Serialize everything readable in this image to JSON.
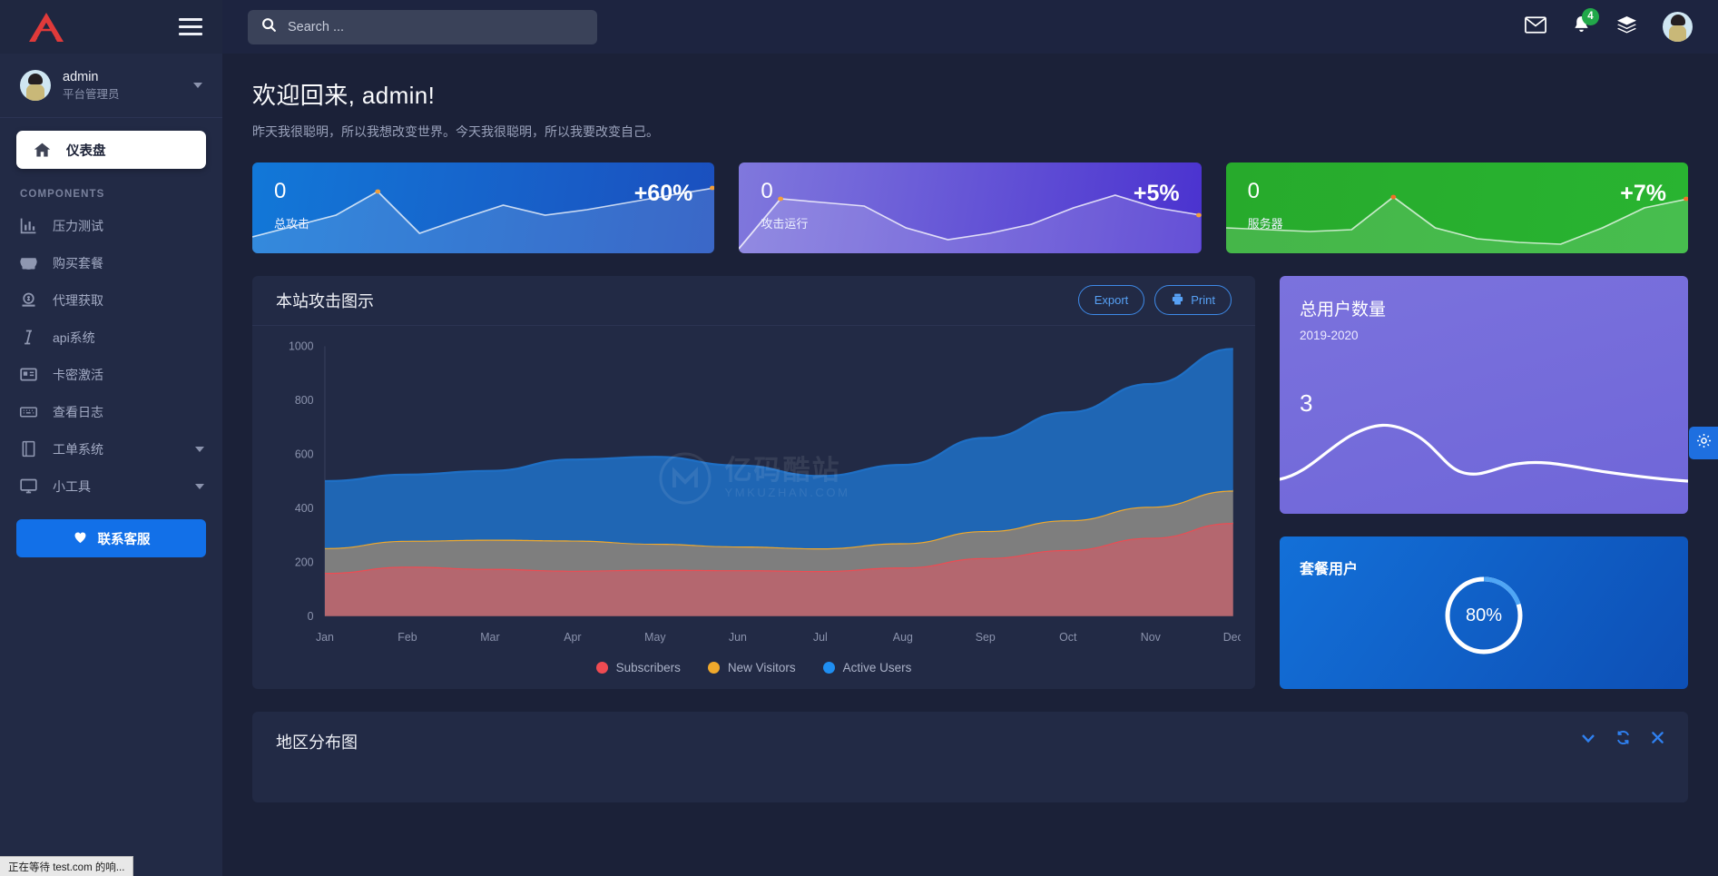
{
  "sidebar": {
    "logo_icon": "triangle-logo-icon",
    "menu_toggle_icon": "hamburger-icon",
    "profile": {
      "name": "admin",
      "role": "平台管理员"
    },
    "active_item": {
      "label": "仪表盘",
      "icon": "home-icon"
    },
    "section_label": "COMPONENTS",
    "items": [
      {
        "label": "压力测试",
        "icon": "chart-bar-icon",
        "expandable": false
      },
      {
        "label": "购买套餐",
        "icon": "store-icon",
        "expandable": false
      },
      {
        "label": "代理获取",
        "icon": "money-icon",
        "expandable": false
      },
      {
        "label": "api系统",
        "icon": "italic-i-icon",
        "expandable": false
      },
      {
        "label": "卡密激活",
        "icon": "id-card-icon",
        "expandable": false
      },
      {
        "label": "查看日志",
        "icon": "keyboard-icon",
        "expandable": false
      },
      {
        "label": "工单系统",
        "icon": "book-icon",
        "expandable": true
      },
      {
        "label": "小工具",
        "icon": "monitor-icon",
        "expandable": true
      }
    ],
    "support_button": {
      "label": "联系客服",
      "icon": "heart-icon"
    }
  },
  "topbar": {
    "search": {
      "placeholder": "Search ...",
      "value": "",
      "icon": "search-icon"
    },
    "mail_icon": "envelope-icon",
    "bell_icon": "bell-icon",
    "bell_badge": "4",
    "layers_icon": "layers-icon",
    "avatar_icon": "user-avatar"
  },
  "welcome": {
    "heading": "欢迎回来, admin!",
    "subtitle": "昨天我很聪明，所以我想改变世界。今天我很聪明，所以我要改变自己。"
  },
  "stat_cards": [
    {
      "value": "0",
      "label": "总攻击",
      "percent": "+60%",
      "color": "#1278d8",
      "spark": [
        28,
        40,
        20,
        66,
        78,
        48,
        30,
        62,
        50,
        58,
        42,
        72
      ]
    },
    {
      "value": "0",
      "label": "攻击运行",
      "percent": "+5%",
      "color": "#5a49d6",
      "spark": [
        10,
        55,
        70,
        68,
        56,
        30,
        26,
        36,
        46,
        62,
        74,
        52
      ]
    },
    {
      "value": "0",
      "label": "服务器",
      "percent": "+7%",
      "color": "#27aa2c",
      "spark": [
        38,
        36,
        34,
        36,
        58,
        80,
        50,
        28,
        24,
        22,
        44,
        70
      ]
    }
  ],
  "chart_panel": {
    "title": "本站攻击图示",
    "export_label": "Export",
    "print_label": "Print",
    "print_icon": "printer-icon",
    "watermark": {
      "cn": "亿码酷站",
      "en": "YMKUZHAN.COM",
      "icon": "watermark-logo-icon"
    }
  },
  "chart_data": {
    "type": "area",
    "stacked": true,
    "title": "本站攻击图示",
    "xlabel": "",
    "ylabel": "",
    "categories": [
      "Jan",
      "Feb",
      "Mar",
      "Apr",
      "May",
      "Jun",
      "Jul",
      "Aug",
      "Sep",
      "Oct",
      "Nov",
      "Dec"
    ],
    "yticks": [
      0,
      200,
      400,
      600,
      800,
      1000
    ],
    "ylim": [
      0,
      1000
    ],
    "grid": false,
    "legend_position": "bottom",
    "series": [
      {
        "name": "Subscribers",
        "color": "#ef4b52",
        "values": [
          160,
          183,
          175,
          168,
          172,
          170,
          167,
          180,
          215,
          245,
          290,
          345
        ]
      },
      {
        "name": "New Visitors",
        "color": "#f0a92c",
        "values": [
          92,
          96,
          108,
          112,
          96,
          88,
          84,
          90,
          100,
          110,
          115,
          120
        ]
      },
      {
        "name": "Active Users",
        "color": "#1f6fc4",
        "values": [
          248,
          245,
          255,
          300,
          322,
          300,
          268,
          290,
          345,
          400,
          455,
          525
        ]
      }
    ]
  },
  "users_card": {
    "title": "总用户数量",
    "subtitle": "2019-2020",
    "value": "3"
  },
  "package_card": {
    "title": "套餐用户",
    "percent_label": "80%",
    "percent_value": 80
  },
  "bottom_panel": {
    "title": "地区分布图",
    "collapse_icon": "chevron-down-icon",
    "refresh_icon": "refresh-icon",
    "close_icon": "close-icon"
  },
  "settings_tab": {
    "icon": "gear-icon"
  },
  "statusbar": {
    "text": "正在等待 test.com 的响..."
  }
}
